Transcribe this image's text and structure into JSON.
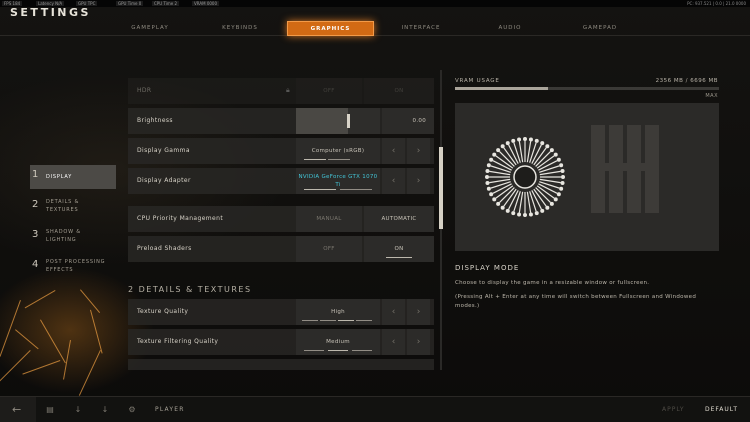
{
  "debug": {
    "fps": "FPS 184",
    "latency": "Latency N/A",
    "gpu_tpc": "GPU TPC",
    "gpu_time": "GPU Time 0",
    "cpu_time": "CPU Time 2",
    "vram": "VRAM 0000",
    "right": "PC: 937.521 | 0.0 | 21.0 0000"
  },
  "title": "SETTINGS",
  "tabs": [
    "GAMEPLAY",
    "KEYBINDS",
    "GRAPHICS",
    "INTERFACE",
    "AUDIO",
    "GAMEPAD"
  ],
  "active_tab": "GRAPHICS",
  "nav": [
    {
      "num": "1",
      "label": "DISPLAY"
    },
    {
      "num": "2",
      "label": "DETAILS &\nTEXTURES"
    },
    {
      "num": "3",
      "label": "SHADOW &\nLIGHTING"
    },
    {
      "num": "4",
      "label": "POST PROCESSING\nEFFECTS"
    }
  ],
  "rows": {
    "hdr": {
      "label": "HDR",
      "opt1": "OFF",
      "opt2": "ON"
    },
    "brightness": {
      "label": "Brightness",
      "value": "0.00",
      "level": 0.62
    },
    "gamma": {
      "label": "Display Gamma",
      "value": "Computer (sRGB)"
    },
    "adapter": {
      "label": "Display Adapter",
      "value": "NVIDIA GeForce GTX 1070 Ti"
    },
    "cpu_priority": {
      "label": "CPU Priority Management",
      "opt1": "MANUAL",
      "opt2": "AUTOMATIC"
    },
    "preload": {
      "label": "Preload Shaders",
      "opt1": "OFF",
      "opt2": "ON"
    },
    "section2": "2 DETAILS & TEXTURES",
    "texture_quality": {
      "label": "Texture Quality",
      "value": "High"
    },
    "texture_filtering": {
      "label": "Texture Filtering Quality",
      "value": "Medium"
    }
  },
  "vram": {
    "label": "VRAM USAGE",
    "value": "2356 MB / 6696 MB",
    "max_label": "MAX",
    "fraction": 0.352
  },
  "mode": {
    "title": "DISPLAY MODE",
    "desc": "Choose to display the game in a resizable window or fullscreen.",
    "note": "(Pressing Alt + Enter at any time will switch between Fullscreen and Windowed modes.)"
  },
  "bottom": {
    "player": "PLAYER",
    "apply": "APPLY",
    "default": "DEFAULT"
  },
  "colors": {
    "accent": "#d26a14",
    "panel": "#2c2b29",
    "text": "#c9c4b8"
  }
}
